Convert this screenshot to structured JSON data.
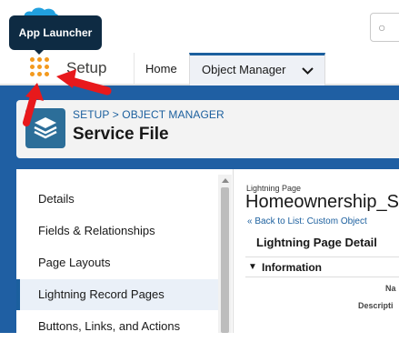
{
  "tooltip": {
    "text": "App Launcher"
  },
  "nav": {
    "app_name": "Setup",
    "tabs": [
      {
        "label": "Home"
      },
      {
        "label": "Object Manager"
      }
    ]
  },
  "header": {
    "breadcrumb": "SETUP > OBJECT MANAGER",
    "title": "Service File"
  },
  "sidebar": {
    "items": [
      {
        "label": "Details"
      },
      {
        "label": "Fields & Relationships"
      },
      {
        "label": "Page Layouts"
      },
      {
        "label": "Lightning Record Pages"
      },
      {
        "label": "Buttons, Links, and Actions"
      }
    ],
    "active_index": 3
  },
  "main": {
    "page_type_label": "Lightning Page",
    "page_title": "Homeownership_S",
    "back_link": "« Back to List: Custom Object",
    "detail_heading": "Lightning Page Detail",
    "section_label": "Information",
    "field_labels": [
      "Na",
      "Descripti"
    ]
  },
  "icons": {
    "logo": "salesforce-cloud-icon",
    "launcher": "app-launcher-waffle-icon",
    "object": "stack-layers-icon",
    "chevron": "chevron-down-icon",
    "annotation": "red-arrow-icon"
  },
  "colors": {
    "brand_blue": "#1f5fa3",
    "link_blue": "#1b5f9e",
    "tooltip_bg": "#0e2b43",
    "waffle_orange": "#f39a1e",
    "annotation_red": "#e8191c",
    "object_icon_bg": "#2c6e99"
  }
}
